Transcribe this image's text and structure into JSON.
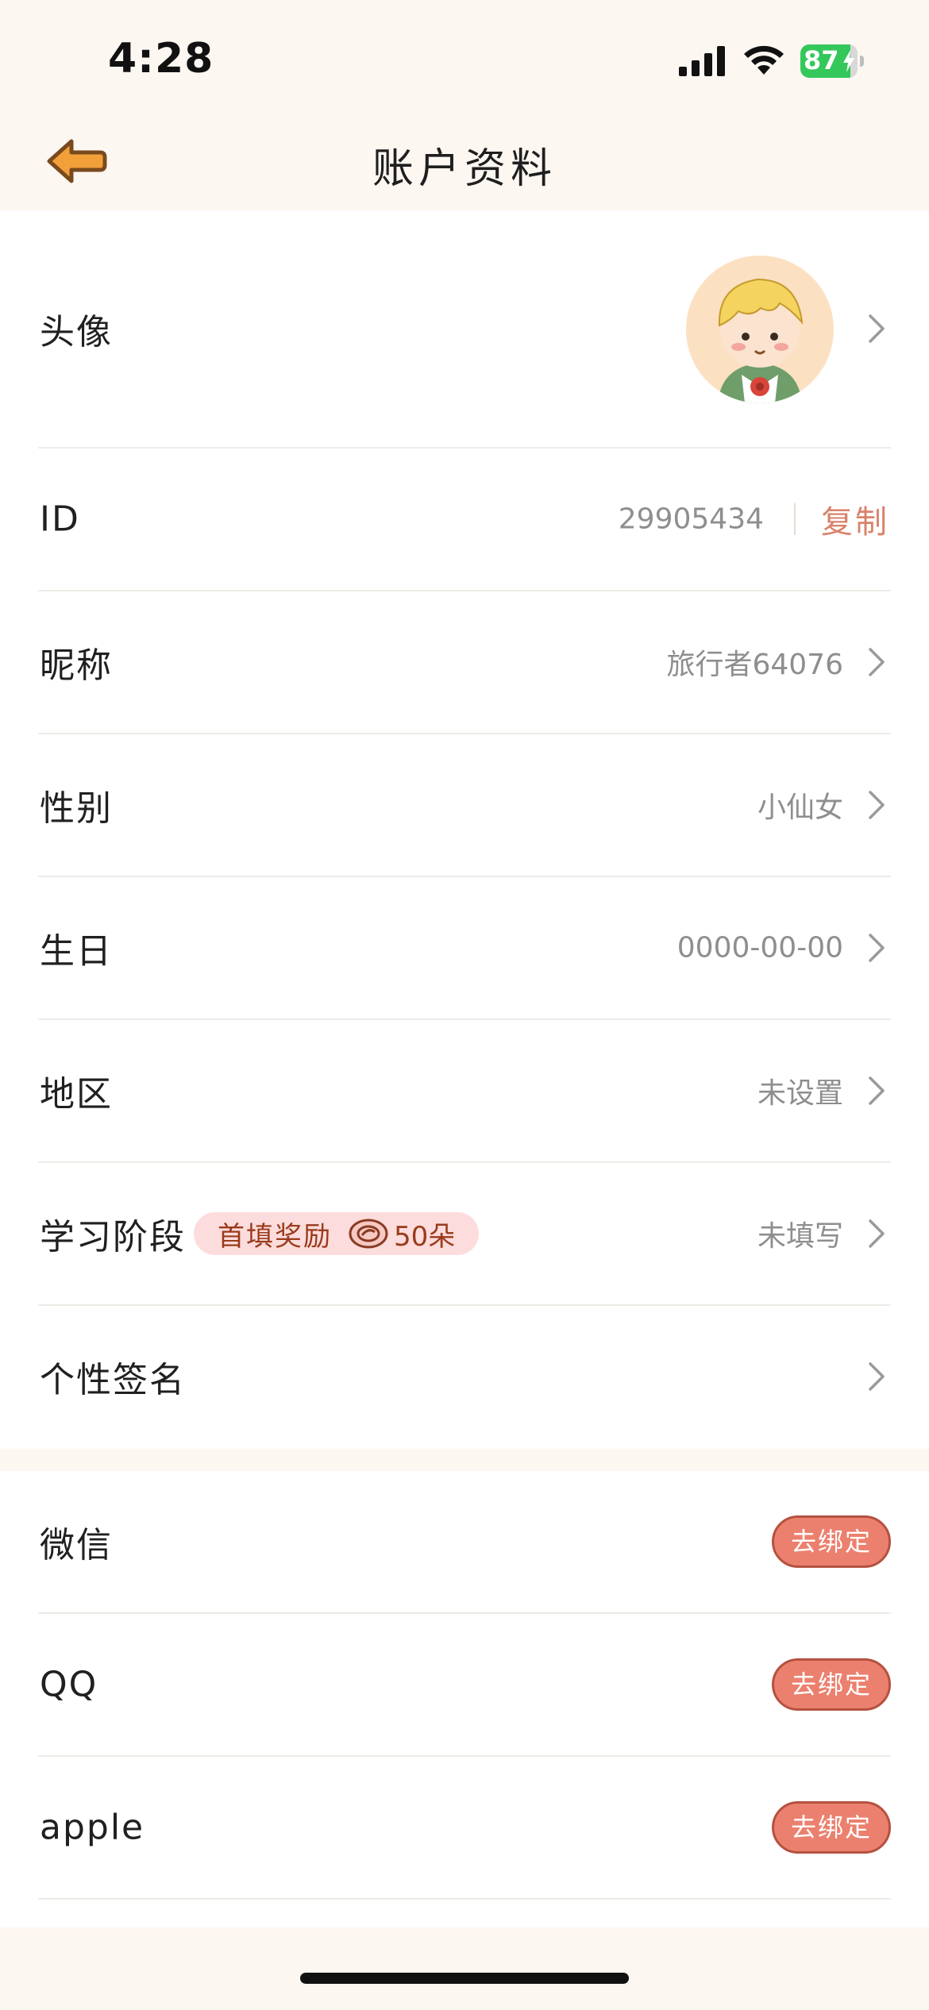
{
  "status_bar": {
    "time": "4:28",
    "battery_percent": "87",
    "battery_level": 0.87,
    "signal_icon": "cellular-signal-icon",
    "wifi_icon": "wifi-icon",
    "battery_icon": "battery-charging-icon"
  },
  "header": {
    "title": "账户资料",
    "back_icon": "back-arrow-icon"
  },
  "profile": {
    "avatar_label": "头像",
    "avatar_image": "cartoon-boy-avatar",
    "id_label": "ID",
    "id_value": "29905434",
    "copy_label": "复制",
    "nickname_label": "昵称",
    "nickname_value": "旅行者64076",
    "gender_label": "性别",
    "gender_value": "小仙女",
    "birthday_label": "生日",
    "birthday_value": "0000-00-00",
    "region_label": "地区",
    "region_value": "未设置",
    "study_stage_label": "学习阶段",
    "study_stage_badge_text": "首填奖励",
    "study_stage_badge_icon": "flower-coin-icon",
    "study_stage_badge_amount": "50朵",
    "study_stage_value": "未填写",
    "signature_label": "个性签名"
  },
  "bindings": [
    {
      "label": "微信",
      "button": "去绑定"
    },
    {
      "label": "QQ",
      "button": "去绑定"
    },
    {
      "label": "apple",
      "button": "去绑定"
    }
  ],
  "colors": {
    "page_background": "#FDF7F1",
    "card_background": "#FFFFFF",
    "accent_copy": "#D9826A",
    "unbind_button": "#EC806E",
    "badge_background": "#FCDCDC",
    "back_arrow": "#F2A03A"
  }
}
